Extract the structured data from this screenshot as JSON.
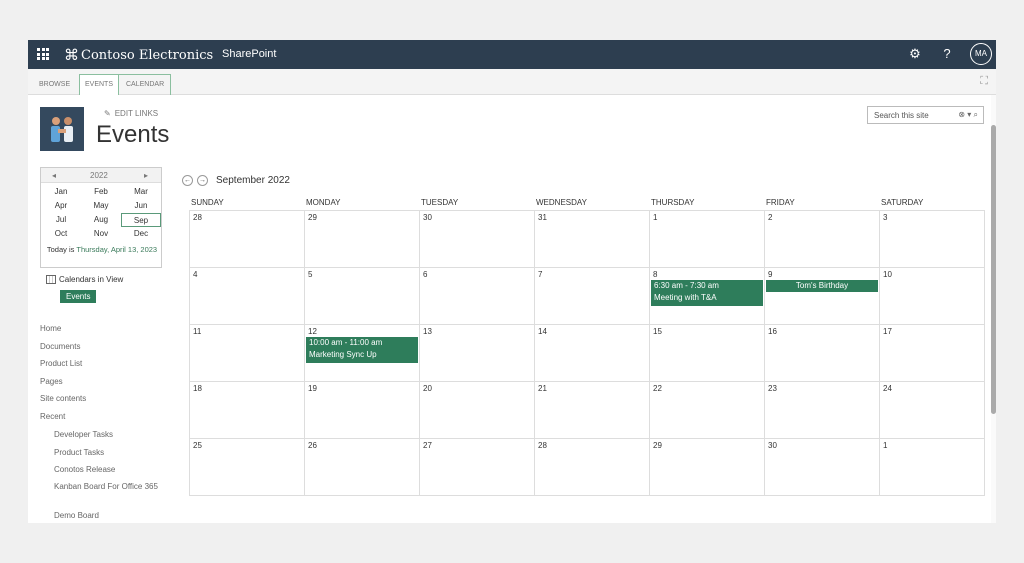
{
  "topbar": {
    "brand_name": "Contoso Electronics",
    "product_name": "SharePoint",
    "user_initials": "MA",
    "icons": [
      "waffle-icon",
      "contoso-logo-icon",
      "gear-icon",
      "help-icon"
    ]
  },
  "ribbon": {
    "tabs": [
      "BROWSE",
      "EVENTS",
      "CALENDAR"
    ],
    "active_tabs": [
      "EVENTS",
      "CALENDAR"
    ]
  },
  "header": {
    "edit_links_label": "EDIT LINKS",
    "page_title": "Events",
    "search_placeholder": "Search this site"
  },
  "date_picker": {
    "year": "2022",
    "months": [
      "Jan",
      "Feb",
      "Mar",
      "Apr",
      "May",
      "Jun",
      "Jul",
      "Aug",
      "Sep",
      "Oct",
      "Nov",
      "Dec"
    ],
    "selected_month": "Sep",
    "today_prefix": "Today is",
    "today_date": "Thursday, April 13, 2023"
  },
  "calendars_in_view": {
    "label": "Calendars in View",
    "item": "Events"
  },
  "left_nav": {
    "items": [
      "Home",
      "Documents",
      "Product List",
      "Pages",
      "Site contents",
      "Recent"
    ],
    "recent": [
      "Developer Tasks",
      "Product Tasks",
      "Conotos Release",
      "Kanban Board For Office 365",
      "Demo Board"
    ]
  },
  "calendar": {
    "month_title": "September 2022",
    "days_of_week": [
      "SUNDAY",
      "MONDAY",
      "TUESDAY",
      "WEDNESDAY",
      "THURSDAY",
      "FRIDAY",
      "SATURDAY"
    ],
    "weeks": [
      [
        "28",
        "29",
        "30",
        "31",
        "1",
        "2",
        "3"
      ],
      [
        "4",
        "5",
        "6",
        "7",
        "8",
        "9",
        "10"
      ],
      [
        "11",
        "12",
        "13",
        "14",
        "15",
        "16",
        "17"
      ],
      [
        "18",
        "19",
        "20",
        "21",
        "22",
        "23",
        "24"
      ],
      [
        "25",
        "26",
        "27",
        "28",
        "29",
        "30",
        "1"
      ]
    ],
    "events": [
      {
        "week": 1,
        "day": 4,
        "time": "6:30 am - 7:30 am",
        "title": "Meeting with T&A"
      },
      {
        "week": 1,
        "day": 5,
        "time": "",
        "title": "Tom's Birthday"
      },
      {
        "week": 2,
        "day": 1,
        "time": "10:00 am - 11:00 am",
        "title": "Marketing Sync Up"
      }
    ],
    "accent_color": "#2e7d5b"
  }
}
